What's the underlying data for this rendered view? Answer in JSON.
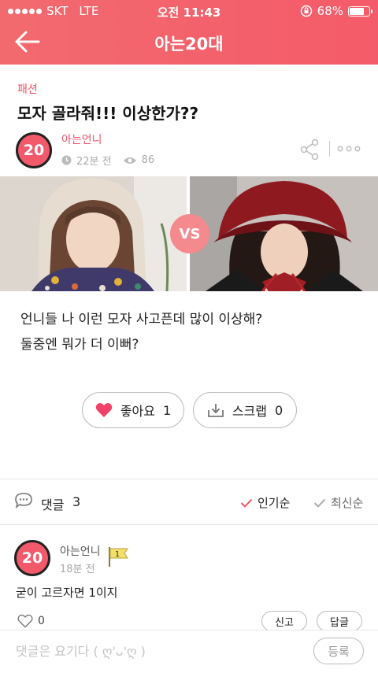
{
  "status": {
    "carrier": "SKT",
    "network": "LTE",
    "time": "오전 11:43",
    "battery": "68%",
    "battery_level": 0.68
  },
  "nav": {
    "title": "아는20대",
    "back_icon": "arrow-left-icon"
  },
  "post": {
    "category": "패션",
    "title": "모자 골라줘!!! 이상한가??",
    "author": {
      "avatar_text": "20",
      "name": "아는언니"
    },
    "time": "22분 전",
    "views": "86",
    "vs_label": "VS",
    "body_lines": [
      "언니들 나 이런 모자 사고픈데 많이 이상해?",
      "둘중엔 뭐가 더 이뻐?"
    ],
    "like": {
      "label": "좋아요",
      "count": "1"
    },
    "scrap": {
      "label": "스크랩",
      "count": "0"
    }
  },
  "comments": {
    "label": "댓글",
    "count": "3",
    "sort_popular": "인기순",
    "sort_latest": "최신순",
    "items": [
      {
        "avatar_text": "20",
        "name": "아는언니",
        "time": "18분 전",
        "badge": "1",
        "text": "굳이 고르자면 1이지",
        "likes": "0",
        "report": "신고",
        "reply": "답글"
      }
    ]
  },
  "input": {
    "placeholder": "댓글은 요기다 ( ღ'ᴗ'ღ )",
    "submit": "등록"
  },
  "colors": {
    "accent": "#f25a6c",
    "header": "#f26a6e"
  }
}
